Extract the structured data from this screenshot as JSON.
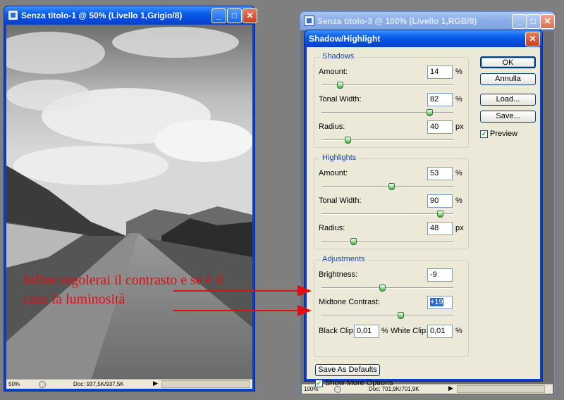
{
  "window_left": {
    "title": "Senza titolo-1 @ 50% (Livello 1,Grigio/8)",
    "zoom": "50%",
    "doc": "Doc: 937,5K/937,5K"
  },
  "window_right": {
    "title": "Senza titolo-3 @ 100% (Livello 1,RGB/8)",
    "zoom": "100%",
    "doc": "Doc: 701,9K/701,9K"
  },
  "dialog": {
    "title": "Shadow/Highlight",
    "shadows": {
      "legend": "Shadows",
      "amount": {
        "label": "Amount:",
        "value": "14",
        "unit": "%",
        "level": 0.14
      },
      "tonal_width": {
        "label": "Tonal Width:",
        "value": "82",
        "unit": "%",
        "level": 0.82
      },
      "radius": {
        "label": "Radius:",
        "value": "40",
        "unit": "px",
        "level": 0.2
      }
    },
    "highlights": {
      "legend": "Highlights",
      "amount": {
        "label": "Amount:",
        "value": "53",
        "unit": "%",
        "level": 0.53
      },
      "tonal_width": {
        "label": "Tonal Width:",
        "value": "90",
        "unit": "%",
        "level": 0.9
      },
      "radius": {
        "label": "Radius:",
        "value": "48",
        "unit": "px",
        "level": 0.24
      }
    },
    "adjustments": {
      "legend": "Adjustments",
      "brightness": {
        "label": "Brightness:",
        "value": "-9",
        "level": 0.46
      },
      "midtone_contrast": {
        "label": "Midtone Contrast:",
        "value": "+19",
        "level": 0.6
      },
      "black_clip": {
        "label": "Black Clip:",
        "value": "0,01",
        "unit": "%"
      },
      "white_clip": {
        "label": "White Clip:",
        "value": "0,01",
        "unit": "%"
      }
    },
    "buttons": {
      "ok": "OK",
      "cancel": "Annulla",
      "load": "Load...",
      "save": "Save...",
      "save_defaults": "Save As Defaults"
    },
    "preview_label": "Preview",
    "show_more_label": "Show More Options"
  },
  "annotation": {
    "line1": "Infine regolerai il contrasto e se è il",
    "line2": "caso la luminosità",
    "color": "#e01010"
  }
}
